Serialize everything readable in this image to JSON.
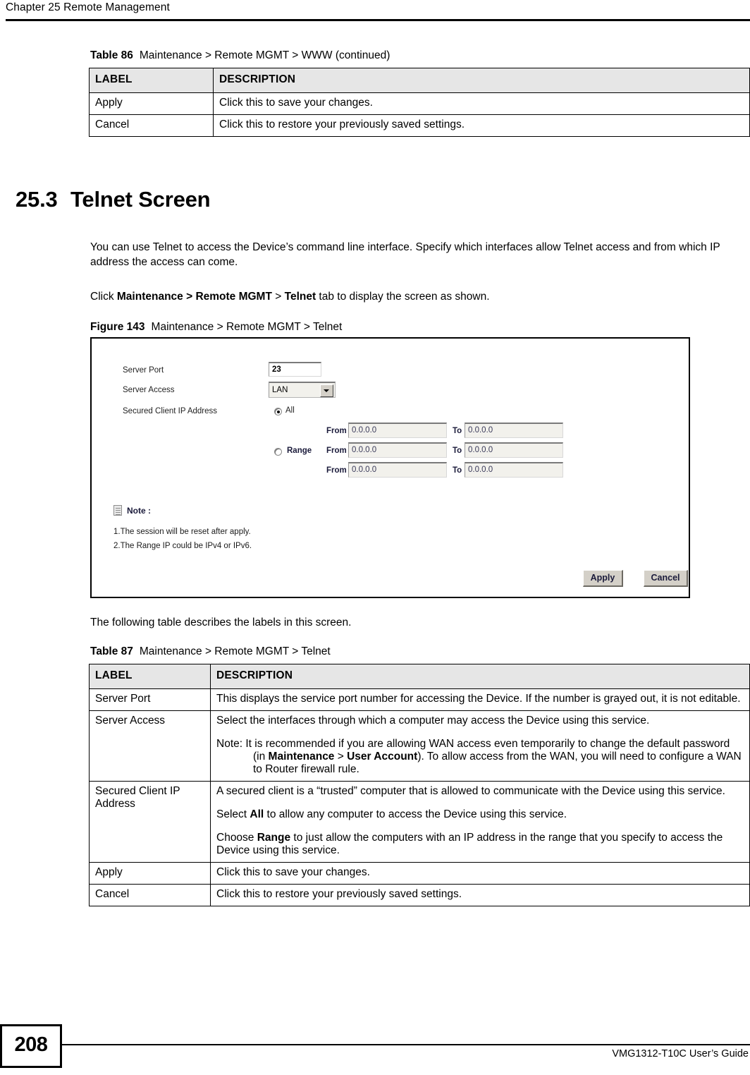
{
  "header": {
    "chapter": "Chapter 25 Remote Management"
  },
  "table86": {
    "caption_label": "Table 86",
    "caption_text": "Maintenance > Remote MGMT > WWW (continued)",
    "columns": [
      "LABEL",
      "DESCRIPTION"
    ],
    "rows": [
      {
        "label": "Apply",
        "description": "Click this to save your changes."
      },
      {
        "label": "Cancel",
        "description": "Click this to restore your previously saved settings."
      }
    ]
  },
  "section": {
    "number": "25.3",
    "title": "Telnet Screen",
    "para1": "You can use Telnet to access the Device’s command line interface. Specify which interfaces allow Telnet access and from which IP address the access can come.",
    "para2_prefix": "Click ",
    "para2_bold1": "Maintenance > Remote MGMT",
    "para2_mid": " > ",
    "para2_bold2": "Telnet",
    "para2_suffix": " tab to display the screen as shown.",
    "para3": "The following table describes the labels in this screen."
  },
  "figure": {
    "caption_label": "Figure 143",
    "caption_text": "Maintenance > Remote MGMT > Telnet",
    "labels": {
      "server_port": "Server Port",
      "server_access": "Server Access",
      "secured_client_ip": "Secured Client IP Address",
      "all": "All",
      "range": "Range",
      "from": "From",
      "to": "To"
    },
    "values": {
      "server_port": "23",
      "server_access": "LAN",
      "ip_placeholder": "0.0.0.0"
    },
    "radios": {
      "all_selected": true,
      "range_selected": false
    },
    "note": {
      "title": "Note :",
      "line1": "1.The session will be reset after apply.",
      "line2": "2.The Range IP could be IPv4 or IPv6."
    },
    "buttons": {
      "apply": "Apply",
      "cancel": "Cancel"
    }
  },
  "table87": {
    "caption_label": "Table 87",
    "caption_text": "Maintenance > Remote MGMT > Telnet",
    "columns": [
      "LABEL",
      "DESCRIPTION"
    ],
    "rows": [
      {
        "label": "Server Port",
        "paragraphs": [
          {
            "text": "This displays the service port number for accessing the Device. If the number is grayed out, it is not editable."
          }
        ]
      },
      {
        "label": "Server Access",
        "paragraphs": [
          {
            "text": "Select the interfaces through which a computer may access the Device using this service."
          },
          {
            "indent": true,
            "segments": [
              {
                "t": "Note: It is recommended if you are allowing WAN access even temporarily to change the default password (in ",
                "b": false
              },
              {
                "t": "Maintenance",
                "b": true
              },
              {
                "t": " > ",
                "b": false
              },
              {
                "t": "User Account",
                "b": true
              },
              {
                "t": "). To allow access from the WAN, you will need to configure a WAN to Router firewall rule.",
                "b": false
              }
            ]
          }
        ]
      },
      {
        "label": "Secured Client IP Address",
        "paragraphs": [
          {
            "text": "A secured client is a “trusted” computer that is allowed to communicate with the Device using this service."
          },
          {
            "segments": [
              {
                "t": "Select ",
                "b": false
              },
              {
                "t": "All",
                "b": true
              },
              {
                "t": " to allow any computer to access the Device using this service.",
                "b": false
              }
            ]
          },
          {
            "segments": [
              {
                "t": "Choose ",
                "b": false
              },
              {
                "t": "Range",
                "b": true
              },
              {
                "t": " to just allow the computers with an IP address in the range that you specify to access the Device using this service.",
                "b": false
              }
            ]
          }
        ]
      },
      {
        "label": "Apply",
        "paragraphs": [
          {
            "text": "Click this to save your changes."
          }
        ]
      },
      {
        "label": "Cancel",
        "paragraphs": [
          {
            "text": "Click this to restore your previously saved settings."
          }
        ]
      }
    ]
  },
  "footer": {
    "page_number": "208",
    "guide": "VMG1312-T10C User’s Guide"
  }
}
